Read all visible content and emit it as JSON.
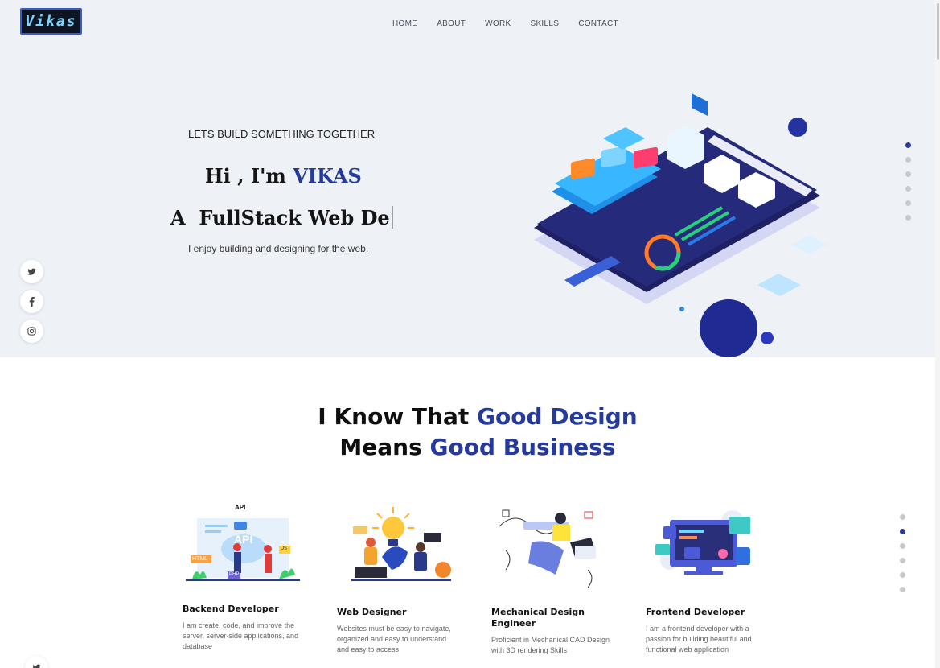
{
  "header": {
    "logo_text": "Vikas",
    "nav": [
      "HOME",
      "ABOUT",
      "WORK",
      "SKILLS",
      "CONTACT"
    ]
  },
  "hero": {
    "tagline": "LETS BUILD SOMETHING TOGETHER",
    "greeting": "Hi , I'm ",
    "name": "VIKAS",
    "role": "A  FullStack Web De",
    "subtitle": "I enjoy building and designing for the web.",
    "section_count": 6,
    "active_section": 0
  },
  "social": [
    "twitter-icon",
    "facebook-icon",
    "instagram-icon"
  ],
  "services": {
    "heading_line1_plain": "I Know That ",
    "heading_line1_accent": "Good Design",
    "heading_line2_plain": "Means ",
    "heading_line2_accent": "Good Business",
    "active_section": 1,
    "cards": [
      {
        "title": "Backend Developer",
        "desc": "I am create, code, and improve the server, server-side applications, and database",
        "art_labels": [
          "API",
          "API",
          "HTML",
          "PHP",
          "JS"
        ]
      },
      {
        "title": "Web Designer",
        "desc": "Websites must be easy to navigate, organized and easy to understand and easy to access"
      },
      {
        "title": "Mechanical Design Engineer",
        "desc": "Proficient in Mechanical CAD Design with 3D rendering Skills"
      },
      {
        "title": "Frontend Developer",
        "desc": "I am a frontend developer with a passion for building beautiful and functional web application"
      }
    ]
  },
  "colors": {
    "accent": "#253a9a",
    "hero_bg": "#eef2f7"
  }
}
